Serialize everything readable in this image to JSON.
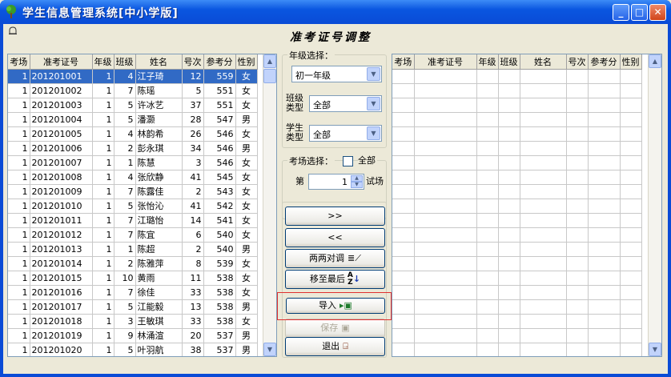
{
  "window": {
    "title": "学生信息管理系统[中小学版]",
    "minimize": "_",
    "maximize": "□",
    "close": "✕"
  },
  "heading": "准考证号调整",
  "columns": [
    "考场",
    "准考证号",
    "年级",
    "班级",
    "姓名",
    "号次",
    "参考分",
    "性别"
  ],
  "left_grid": {
    "rows": [
      [
        "1",
        "201201001",
        "1",
        "4",
        "江子琦",
        "12",
        "559",
        "女"
      ],
      [
        "1",
        "201201002",
        "1",
        "7",
        "陈瑶",
        "5",
        "551",
        "女"
      ],
      [
        "1",
        "201201003",
        "1",
        "5",
        "许冰艺",
        "37",
        "551",
        "女"
      ],
      [
        "1",
        "201201004",
        "1",
        "5",
        "潘灏",
        "28",
        "547",
        "男"
      ],
      [
        "1",
        "201201005",
        "1",
        "4",
        "林韵希",
        "26",
        "546",
        "女"
      ],
      [
        "1",
        "201201006",
        "1",
        "2",
        "彭永琪",
        "34",
        "546",
        "男"
      ],
      [
        "1",
        "201201007",
        "1",
        "1",
        "陈慧",
        "3",
        "546",
        "女"
      ],
      [
        "1",
        "201201008",
        "1",
        "4",
        "张欣静",
        "41",
        "545",
        "女"
      ],
      [
        "1",
        "201201009",
        "1",
        "7",
        "陈露佳",
        "2",
        "543",
        "女"
      ],
      [
        "1",
        "201201010",
        "1",
        "5",
        "张怡沁",
        "41",
        "542",
        "女"
      ],
      [
        "1",
        "201201011",
        "1",
        "7",
        "江璐怡",
        "14",
        "541",
        "女"
      ],
      [
        "1",
        "201201012",
        "1",
        "7",
        "陈宜",
        "6",
        "540",
        "女"
      ],
      [
        "1",
        "201201013",
        "1",
        "1",
        "陈超",
        "2",
        "540",
        "男"
      ],
      [
        "1",
        "201201014",
        "1",
        "2",
        "陈雅萍",
        "8",
        "539",
        "女"
      ],
      [
        "1",
        "201201015",
        "1",
        "10",
        "黄雨",
        "11",
        "538",
        "女"
      ],
      [
        "1",
        "201201016",
        "1",
        "7",
        "徐佳",
        "33",
        "538",
        "女"
      ],
      [
        "1",
        "201201017",
        "1",
        "5",
        "江能毅",
        "13",
        "538",
        "男"
      ],
      [
        "1",
        "201201018",
        "1",
        "3",
        "王敏琪",
        "33",
        "538",
        "女"
      ],
      [
        "1",
        "201201019",
        "1",
        "9",
        "林涌渲",
        "20",
        "537",
        "男"
      ],
      [
        "1",
        "201201020",
        "1",
        "5",
        "叶羽航",
        "38",
        "537",
        "男"
      ]
    ]
  },
  "grade_group": {
    "label": "年级选择：",
    "grade_value": "初一年级",
    "class_type_label_1": "班级",
    "class_type_label_2": "类型",
    "class_type_value": "全部",
    "student_type_label_1": "学生",
    "student_type_label_2": "类型",
    "student_type_value": "全部"
  },
  "room_group": {
    "label": "考场选择：",
    "all_label": "全部",
    "prefix": "第",
    "room_value": "1",
    "suffix": "试场"
  },
  "buttons": {
    "move_right": ">>",
    "move_left": "<<",
    "swap": "两两对调",
    "move_last": "移至最后",
    "import": "导入",
    "save": "保存",
    "exit": "退出"
  }
}
